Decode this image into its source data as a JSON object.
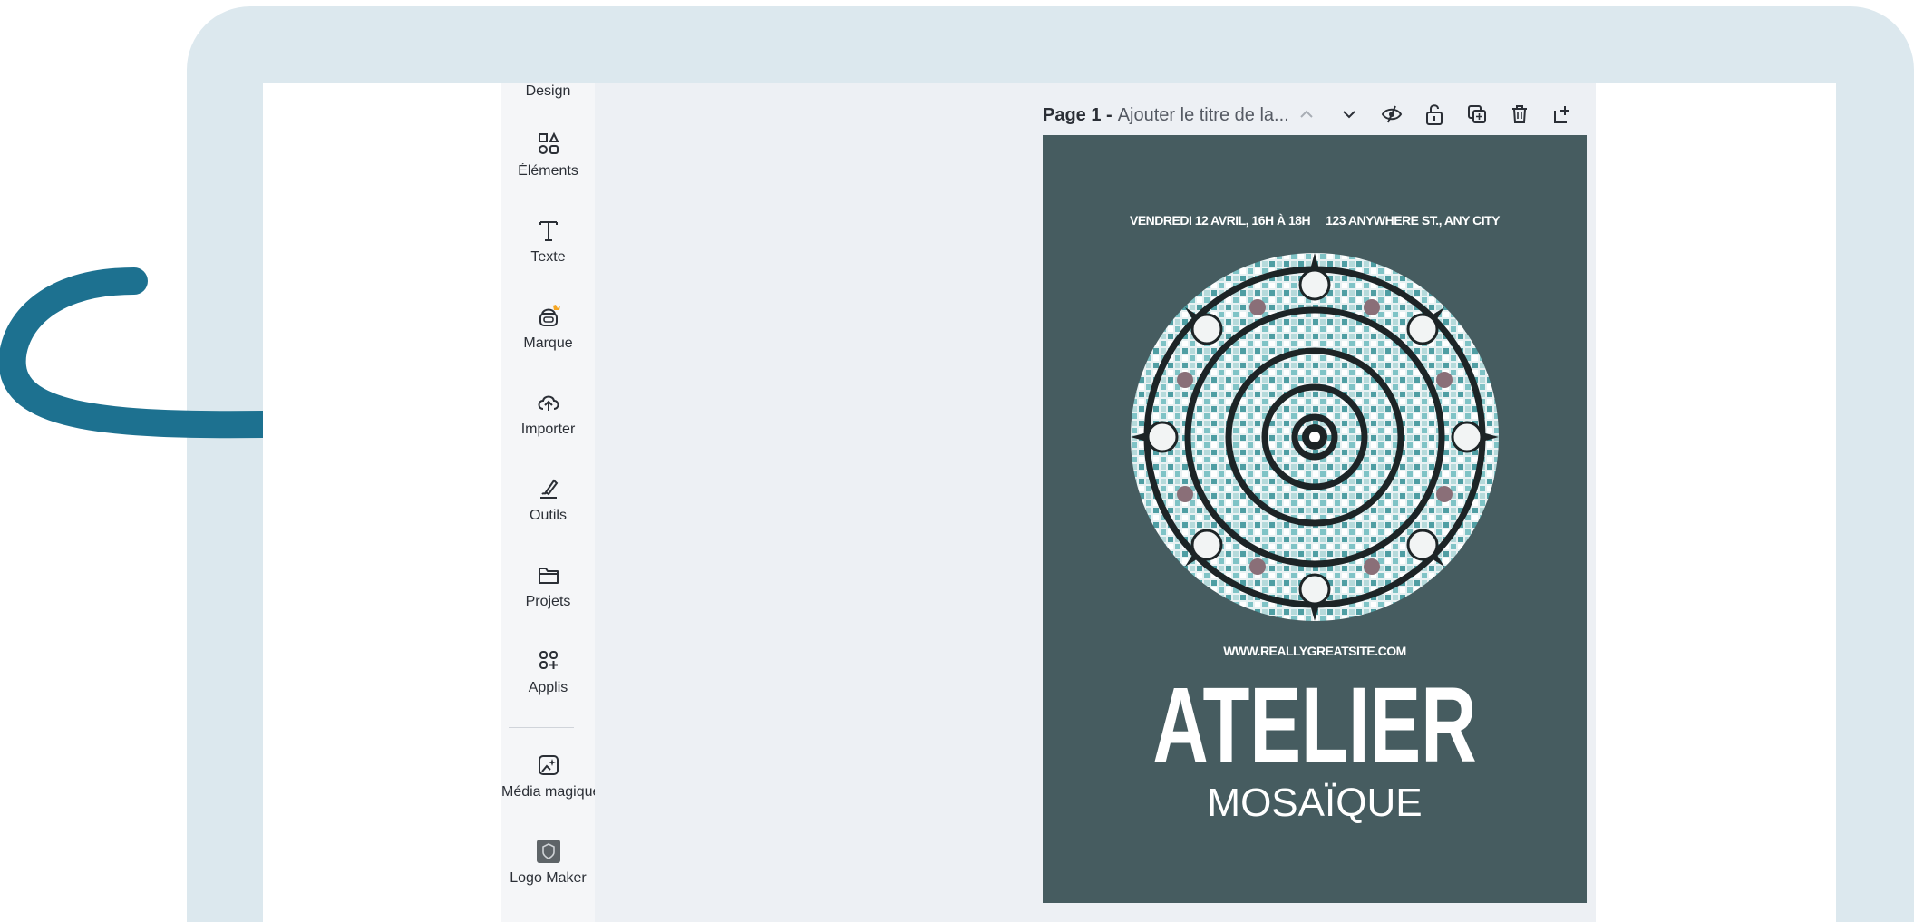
{
  "sidebar": {
    "items": [
      {
        "label": "Design",
        "icon": "design-icon"
      },
      {
        "label": "Éléments",
        "icon": "elements-icon"
      },
      {
        "label": "Texte",
        "icon": "text-icon"
      },
      {
        "label": "Marque",
        "icon": "brand-icon"
      },
      {
        "label": "Importer",
        "icon": "upload-icon"
      },
      {
        "label": "Outils",
        "icon": "tools-icon"
      },
      {
        "label": "Projets",
        "icon": "folder-icon"
      },
      {
        "label": "Applis",
        "icon": "apps-icon"
      },
      {
        "label": "Média magique",
        "icon": "magic-media-icon"
      },
      {
        "label": "Logo Maker",
        "icon": "logo-maker-icon"
      }
    ]
  },
  "page_bar": {
    "page_label": "Page 1 -",
    "title_placeholder": "Ajouter le titre de la..."
  },
  "poster": {
    "info_line": "VENDREDI 12 AVRIL, 16H À 18H     123 ANYWHERE ST., ANY CITY",
    "website": "WWW.REALLYGREATSITE.COM",
    "title": "ATELIER",
    "subtitle": "MOSAÏQUE",
    "background_color": "#465c60"
  },
  "colors": {
    "frame": "#dce8ee",
    "arrow": "#1d7190",
    "crown_badge": "#f5a623"
  }
}
